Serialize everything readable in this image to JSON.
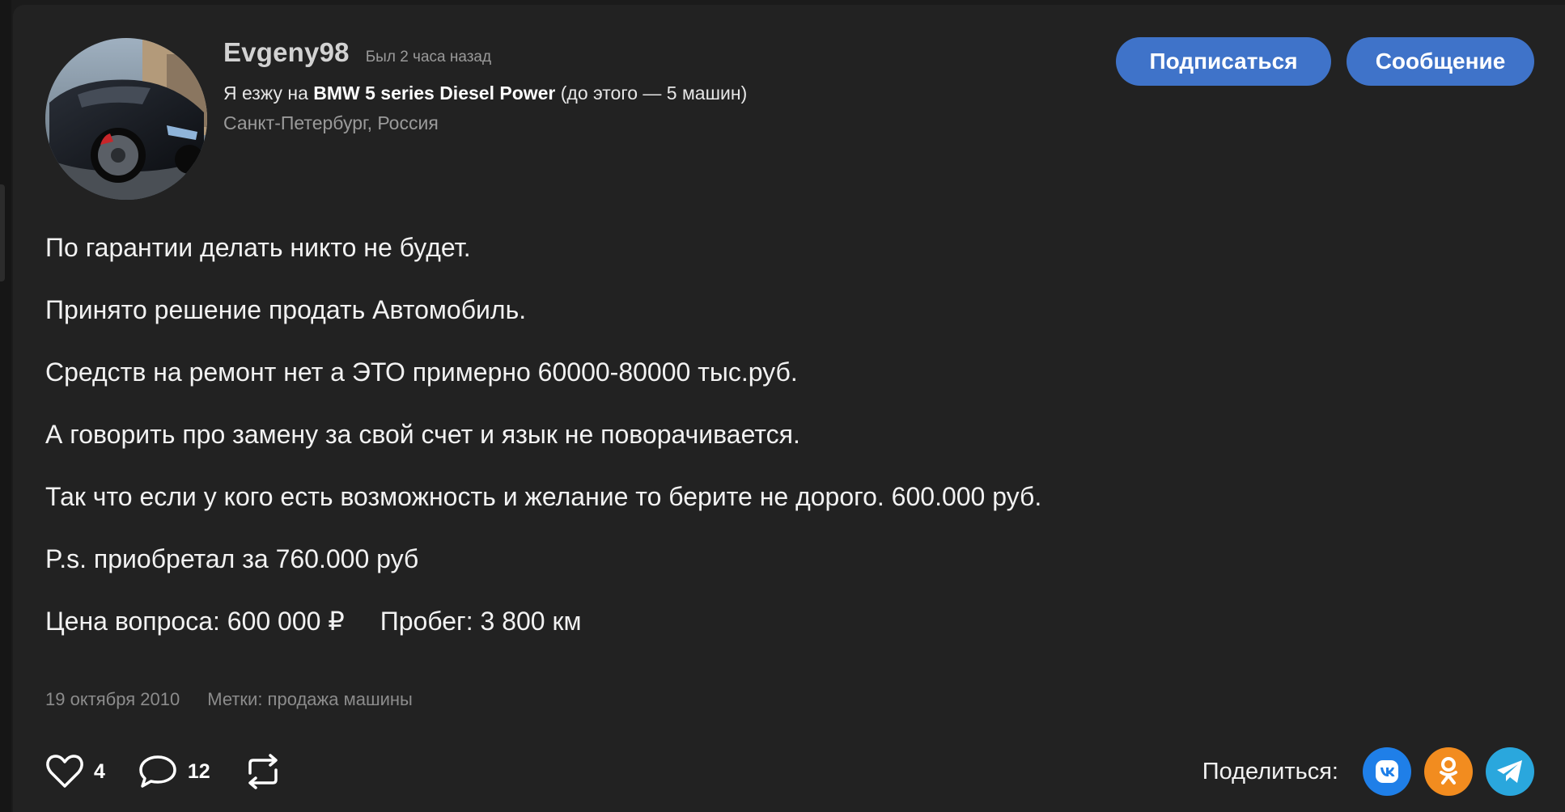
{
  "author": {
    "username": "Evgeny98",
    "last_seen": "Был 2 часа назад",
    "drives_prefix": "Я езжу на",
    "car_name": "BMW 5 series Diesel Power",
    "drives_suffix": "(до этого — 5 машин)",
    "location": "Санкт-Петербург, Россия"
  },
  "buttons": {
    "subscribe": "Подписаться",
    "message": "Сообщение"
  },
  "post": {
    "lines": [
      "По гарантии делать никто не будет.",
      "Принято решение продать Автомобиль.",
      "Средств на ремонт нет а ЭТО примерно 60000-80000 тыс.руб.",
      "А говорить про замену за свой счет и язык не поворачивается.",
      "Так что если у кого есть возможность и желание то берите не дорого. 600.000 руб.",
      "P.s. приобретал за 760.000 руб"
    ],
    "price": "Цена вопроса: 600 000 ₽",
    "mileage": "Пробег: 3 800 км",
    "date": "19 октября 2010",
    "tags": "Метки: продажа машины"
  },
  "actions": {
    "likes": "4",
    "comments": "12"
  },
  "share": {
    "label": "Поделиться:",
    "vk_label": "VK",
    "ok_label": "OK",
    "tg_label": "Telegram"
  },
  "icons": {
    "like": "heart-icon",
    "comment": "comment-bubble-icon",
    "repost": "repost-icon",
    "vk": "vk-icon",
    "ok": "odnoklassniki-icon",
    "tg": "telegram-icon"
  },
  "colors": {
    "background": "#222222",
    "accent_button": "#3f73c9",
    "vk": "#1f7fe8",
    "ok": "#f28c1f",
    "telegram": "#2aa7dd",
    "muted_text": "#9a9a9a"
  }
}
